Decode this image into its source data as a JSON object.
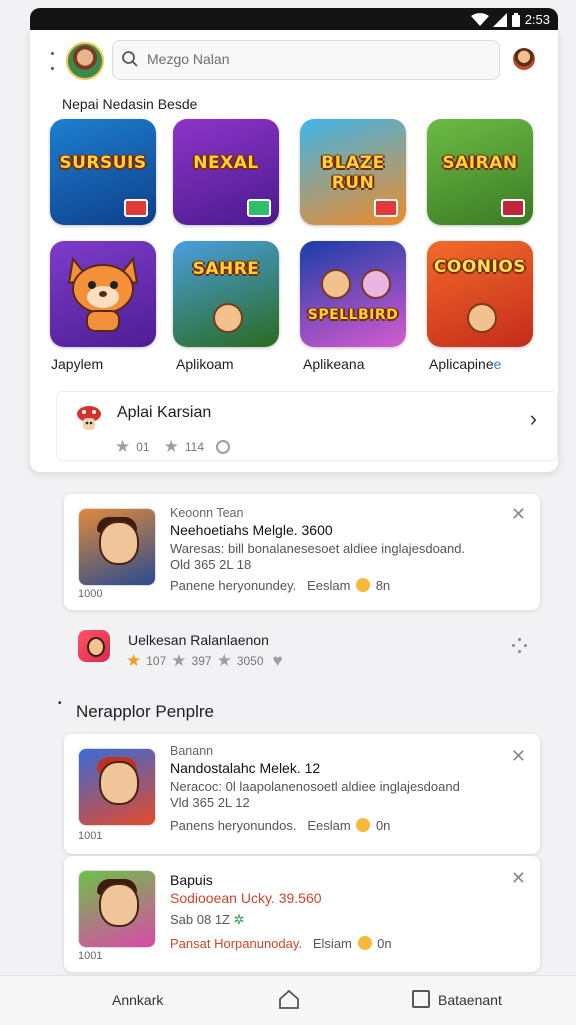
{
  "status": {
    "time": "2:53"
  },
  "search": {
    "placeholder": "Mezgo Nalan"
  },
  "section_title": "Nepai Nedasin Besde",
  "apps": [
    {
      "logo": "SURSUIS",
      "label": "Japylem",
      "colors": [
        "#1d7fcf",
        "#0e3f8b"
      ]
    },
    {
      "logo": "NEXAL",
      "label": "Aplikoam",
      "colors": [
        "#8e34c9",
        "#4a1b8e"
      ]
    },
    {
      "logo": "BLAZE RUN",
      "label": "Aplikeana",
      "colors": [
        "#3fb6e8",
        "#f08b2a"
      ]
    },
    {
      "logo": "SAIRAN",
      "label": "Aplicapinen",
      "label_accent": "e",
      "colors": [
        "#6dbb45",
        "#3a7b24"
      ]
    },
    {
      "logo": "",
      "label": "",
      "colors": [
        "#7d3cc9",
        "#4e1e95"
      ]
    },
    {
      "logo": "SAHRE",
      "label": "",
      "colors": [
        "#4a9ee0",
        "#2a6b1f"
      ]
    },
    {
      "logo": "SPELLBIRD",
      "label": "",
      "colors": [
        "#1a3da8",
        "#d65bd0"
      ]
    },
    {
      "logo": "COONIOS",
      "label": "",
      "colors": [
        "#f36b2a",
        "#c42c1a"
      ]
    }
  ],
  "featured": {
    "title": "Aplai Karsian",
    "rating1": "01",
    "rating2": "114"
  },
  "card1": {
    "small": "Keoonn Tean",
    "head": "Neehoetiahs Melgle. 3600",
    "body1": "Waresas: bill bonalanesesoet aldiee inglajesdoand.",
    "body2": "Old 365 2L 18",
    "footer_a": "Panene heryonundey.",
    "footer_b": "Eeslam",
    "footer_c": "8n",
    "caption": "1000"
  },
  "row": {
    "title": "Uelkesan Ralanlaenon",
    "r1": "107",
    "r2": "397",
    "r3": "3050"
  },
  "section2": "Nerapplor Penplre",
  "card2": {
    "small": "Banann",
    "head": "Nandostalahc Melek. 12",
    "body1": "Neracoc: 0l laapolanenosoetl aldiee inglajesdoand",
    "body2": "Vld 365 2L 12",
    "footer_a": "Panens heryonundos.",
    "footer_b": "Eeslam",
    "footer_c": "0n",
    "caption": "1001"
  },
  "card3": {
    "small": "Bapuis",
    "head": "Sodiooean Ucky. 39.560",
    "body2": "Sab 08 1Z",
    "footer_a": "Pansat Horpanunoday.",
    "footer_b": "Elsiam",
    "footer_c": "0n",
    "caption": "1001"
  },
  "nav": {
    "left": "Annkark",
    "right": "Bataenant"
  }
}
